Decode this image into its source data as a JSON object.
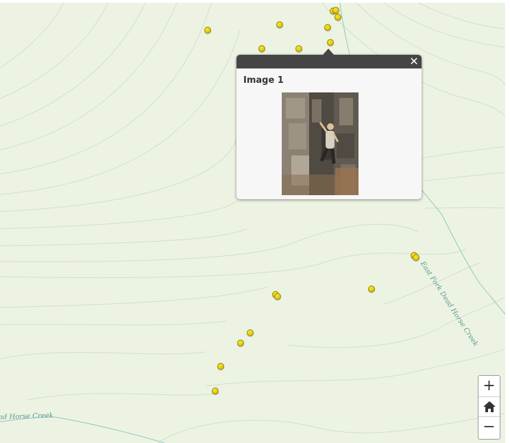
{
  "map": {
    "labels": {
      "east_fork_creek": "East Fork Dead Horse Creek",
      "dead_horse_creek": "ad Horse Creek"
    },
    "marker_count": 23,
    "colors": {
      "land": "#edf3e3",
      "contour": "#d4dfcc",
      "water": "#8cc9c0",
      "marker": "#e2cc10"
    }
  },
  "popup": {
    "title": "Image 1",
    "close_label": "✕",
    "photo_icon": "rock-climber-photo"
  },
  "zoom": {
    "zoom_in_label": "+",
    "home_icon": "home-icon",
    "zoom_out_label": "−"
  }
}
